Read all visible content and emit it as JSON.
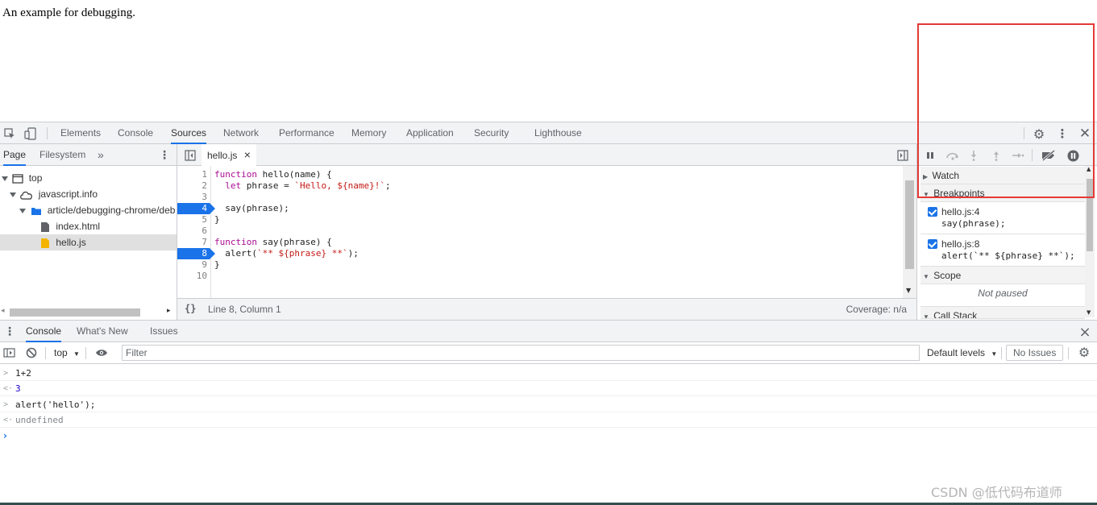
{
  "page": {
    "text": "An example for debugging."
  },
  "devtools": {
    "tabs": [
      "Elements",
      "Console",
      "Sources",
      "Network",
      "Performance",
      "Memory",
      "Application",
      "Security",
      "Lighthouse"
    ],
    "active_tab": "Sources"
  },
  "navigator": {
    "tabs": [
      "Page",
      "Filesystem"
    ],
    "more": "»",
    "tree": [
      {
        "label": "top",
        "depth": 0,
        "kind": "frame"
      },
      {
        "label": "javascript.info",
        "depth": 1,
        "kind": "cloud"
      },
      {
        "label": "article/debugging-chrome/deb",
        "depth": 2,
        "kind": "folder"
      },
      {
        "label": "index.html",
        "depth": 3,
        "kind": "file"
      },
      {
        "label": "hello.js",
        "depth": 3,
        "kind": "jsfile",
        "selected": true
      }
    ]
  },
  "editor": {
    "open_file": "hello.js",
    "close": "×",
    "line_numbers": [
      "1",
      "2",
      "3",
      "4",
      "5",
      "6",
      "7",
      "8",
      "9",
      "10"
    ],
    "breakpoint_lines": [
      4,
      8
    ],
    "status_position": "Line 8, Column 1",
    "status_coverage": "Coverage: n/a",
    "format_icon_text": "{}"
  },
  "debugger": {
    "watch": "Watch",
    "breakpoints": "Breakpoints",
    "breakpoint_items": [
      {
        "location": "hello.js:4",
        "code": "say(phrase);"
      },
      {
        "location": "hello.js:8",
        "code": "alert(`** ${phrase} **`);"
      }
    ],
    "scope": "Scope",
    "not_paused": "Not paused",
    "call_stack": "Call Stack"
  },
  "drawer": {
    "tabs": [
      "Console",
      "What's New",
      "Issues"
    ],
    "active_tab": "Console",
    "close": "×",
    "context": "top",
    "filter_placeholder": "Filter",
    "levels": "Default levels",
    "issues_button": "No Issues",
    "lines": [
      {
        "kind": "input",
        "text": "1+2"
      },
      {
        "kind": "result",
        "text": "3"
      },
      {
        "kind": "input",
        "text": "alert('hello');"
      },
      {
        "kind": "result",
        "text": "undefined"
      }
    ]
  },
  "watermark": "CSDN @低代码布道师",
  "colors": {
    "accent": "#1a73e8",
    "highlight_box": "#e53935",
    "keyword": "#aa0d91",
    "string": "#c41a16"
  }
}
